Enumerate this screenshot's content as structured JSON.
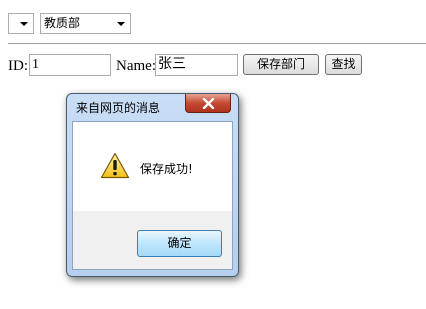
{
  "toolbar": {
    "first_select_value": "",
    "dept_select_value": "教质部"
  },
  "form": {
    "id_label": "ID:",
    "id_value": "1",
    "name_label": "Name:",
    "name_value": "张三",
    "save_button": "保存部门",
    "search_button": "查找"
  },
  "dialog": {
    "title": "来自网页的消息",
    "message": "保存成功!",
    "ok_button": "确定",
    "icon": "warning-icon"
  }
}
